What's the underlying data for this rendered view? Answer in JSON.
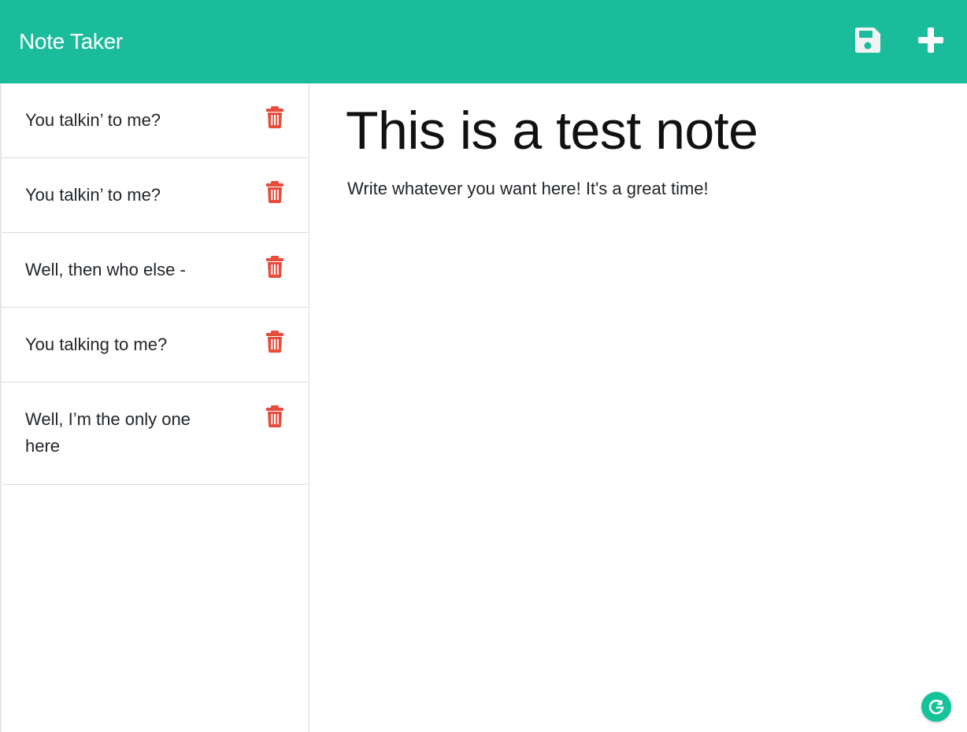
{
  "app": {
    "title": "Note Taker",
    "brand_color": "#1abc9c",
    "delete_color": "#e74c3c"
  },
  "toolbar": {
    "save_icon": "save-icon",
    "new_icon": "plus-icon"
  },
  "notes": [
    {
      "title": "You talkin’ to me?"
    },
    {
      "title": "You talkin’ to me?"
    },
    {
      "title": "Well, then who else -"
    },
    {
      "title": "You talking to me?"
    },
    {
      "title": "Well, I’m the only one here"
    }
  ],
  "active_note": {
    "title": "This is a test note",
    "text": "Write whatever you want here! It's a great time!"
  },
  "assistant_badge": {
    "icon": "grammarly-icon",
    "color": "#15c39a"
  }
}
